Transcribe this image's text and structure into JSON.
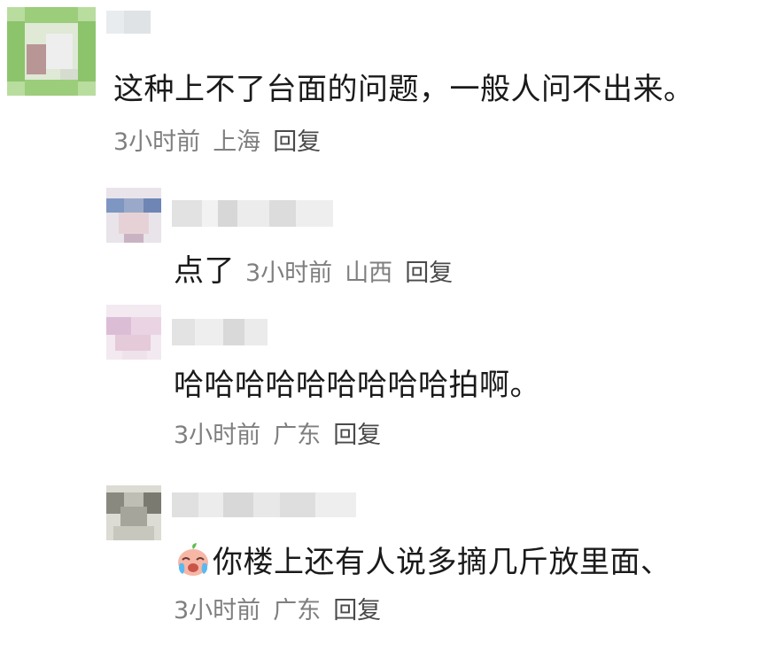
{
  "comments": [
    {
      "text": "这种上不了台面的问题，一般人问不出来。",
      "time": "3小时前",
      "location": "上海",
      "reply_label": "回复",
      "avatar_colors": [
        "#7dbb5c",
        "#a9d08c",
        "#c6b7b3",
        "#9fcf7f"
      ]
    },
    {
      "text": "点了",
      "time": "3小时前",
      "location": "山西",
      "reply_label": "回复",
      "avatar_colors": [
        "#8aa0c8",
        "#c9b3c2",
        "#e8d5d8",
        "#6f86b5"
      ]
    },
    {
      "text": "哈哈哈哈哈哈哈哈哈拍啊。",
      "time": "3小时前",
      "location": "广东",
      "reply_label": "回复",
      "avatar_colors": [
        "#e2c7de",
        "#f0dde8",
        "#d9b6cf",
        "#efe3ea"
      ]
    },
    {
      "emoji": "crying-laugh-emoji",
      "text": "你楼上还有人说多摘几斤放里面、",
      "time": "3小时前",
      "location": "广东",
      "reply_label": "回复",
      "avatar_colors": [
        "#7d7d73",
        "#b7b6ad",
        "#9a998f",
        "#d0cfc6"
      ]
    }
  ]
}
